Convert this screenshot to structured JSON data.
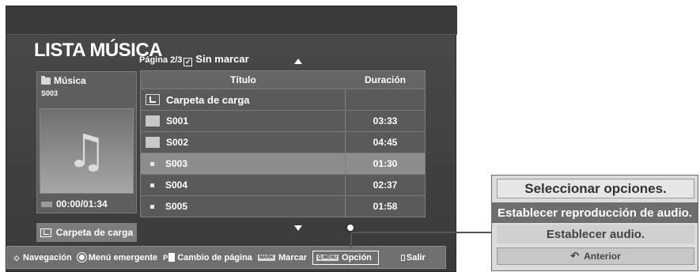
{
  "header": {
    "title": "LISTA MÚSICA",
    "page": "Página 2/3",
    "mark_symbol": "✓",
    "unmark_label": "Sin marcar"
  },
  "info_panel": {
    "folder_name": "Música",
    "file": "S003",
    "time": "00:00/01:34",
    "music_icon": "music-note-icon"
  },
  "upload_button": {
    "label": "Carpeta de carga"
  },
  "list": {
    "columns": [
      "Título",
      "Duración"
    ],
    "rows": [
      {
        "title": "Carpeta de carga",
        "duration": "",
        "icon": "folder-up-icon"
      },
      {
        "title": "S001",
        "duration": "03:33",
        "icon": "folder-icon"
      },
      {
        "title": "S002",
        "duration": "04:45",
        "icon": "folder-icon"
      },
      {
        "title": "S003",
        "duration": "01:30",
        "icon": "file-dot-icon",
        "selected": true
      },
      {
        "title": "S004",
        "duration": "02:37",
        "icon": "file-dot-icon"
      },
      {
        "title": "S005",
        "duration": "01:58",
        "icon": "file-dot-icon"
      }
    ]
  },
  "bottom_bar": {
    "nav": "Navegación",
    "popup": "Menú emergente",
    "p_label": "P",
    "page_change": "Cambio de página",
    "mark_tag": "MARK",
    "mark": "Marcar",
    "qmenu_tag": "Q.MENU",
    "option": "Opción",
    "exit": "Salir"
  },
  "options_menu": {
    "title": "Seleccionar opciones.",
    "items": [
      "Establecer reproducción de audio.",
      "Establecer audio."
    ],
    "back": "Anterior"
  }
}
